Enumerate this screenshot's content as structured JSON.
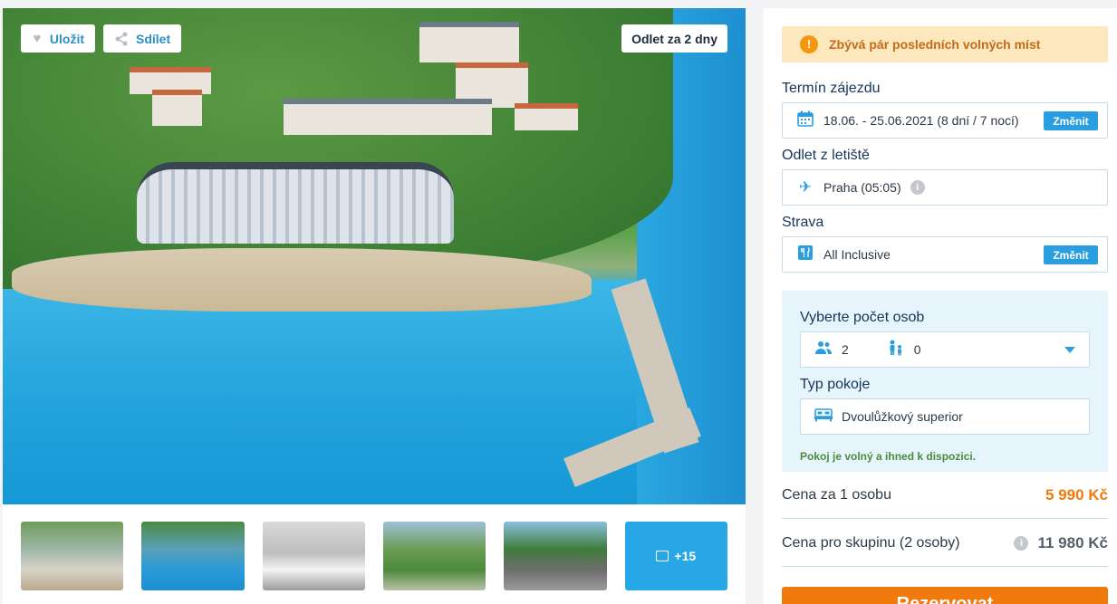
{
  "gallery": {
    "save_label": "Uložit",
    "share_label": "Sdílet",
    "departure_badge": "Odlet za 2 dny",
    "more_photos": "+15",
    "icons": {
      "save": "heart-icon",
      "share": "share-icon",
      "more": "image-icon"
    }
  },
  "panel": {
    "alert_text": "Zbývá pár posledních volných míst",
    "term": {
      "label": "Termín zájezdu",
      "value": "18.06. - 25.06.2021 (8 dní / 7 nocí)",
      "change": "Změnit"
    },
    "departure": {
      "label": "Odlet z letiště",
      "value": "Praha (05:05)"
    },
    "board": {
      "label": "Strava",
      "value": "All Inclusive",
      "change": "Změnit"
    },
    "persons": {
      "label": "Vyberte počet osob",
      "adults": "2",
      "children": "0"
    },
    "room": {
      "label": "Typ pokoje",
      "value": "Dvoulůžkový superior",
      "availability": "Pokoj je volný a ihned k dispozici."
    },
    "price_per_person": {
      "label": "Cena za 1 osobu",
      "value": "5 990 Kč"
    },
    "price_group": {
      "label": "Cena pro skupinu (2 osoby)",
      "value": "11 980 Kč"
    },
    "book_label": "Rezervovat"
  },
  "colors": {
    "accent": "#2a9ee0",
    "orange": "#f07a0c",
    "alert_bg": "#fde7bd",
    "panel_tint": "#e6f4fb"
  }
}
